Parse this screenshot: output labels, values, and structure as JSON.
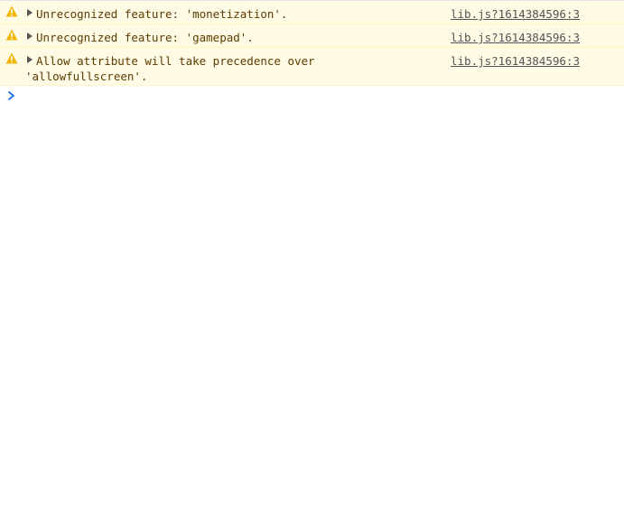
{
  "console": {
    "messages": [
      {
        "level": "warning",
        "icon": "warning-icon",
        "text": "Unrecognized feature: 'monetization'.",
        "text_cont": "",
        "source": "lib.js?1614384596:3"
      },
      {
        "level": "warning",
        "icon": "warning-icon",
        "text": "Unrecognized feature: 'gamepad'.",
        "text_cont": "",
        "source": "lib.js?1614384596:3"
      },
      {
        "level": "warning",
        "icon": "warning-icon",
        "text": "Allow attribute will take precedence over",
        "text_cont": "'allowfullscreen'.",
        "source": "lib.js?1614384596:3"
      }
    ],
    "prompt_icon": "chevron-right-icon"
  },
  "colors": {
    "warning_bg": "#fffbe5",
    "warning_text": "#5c3b00",
    "warning_icon": "#f2b600",
    "link": "#545454",
    "prompt": "#1a73e8"
  }
}
